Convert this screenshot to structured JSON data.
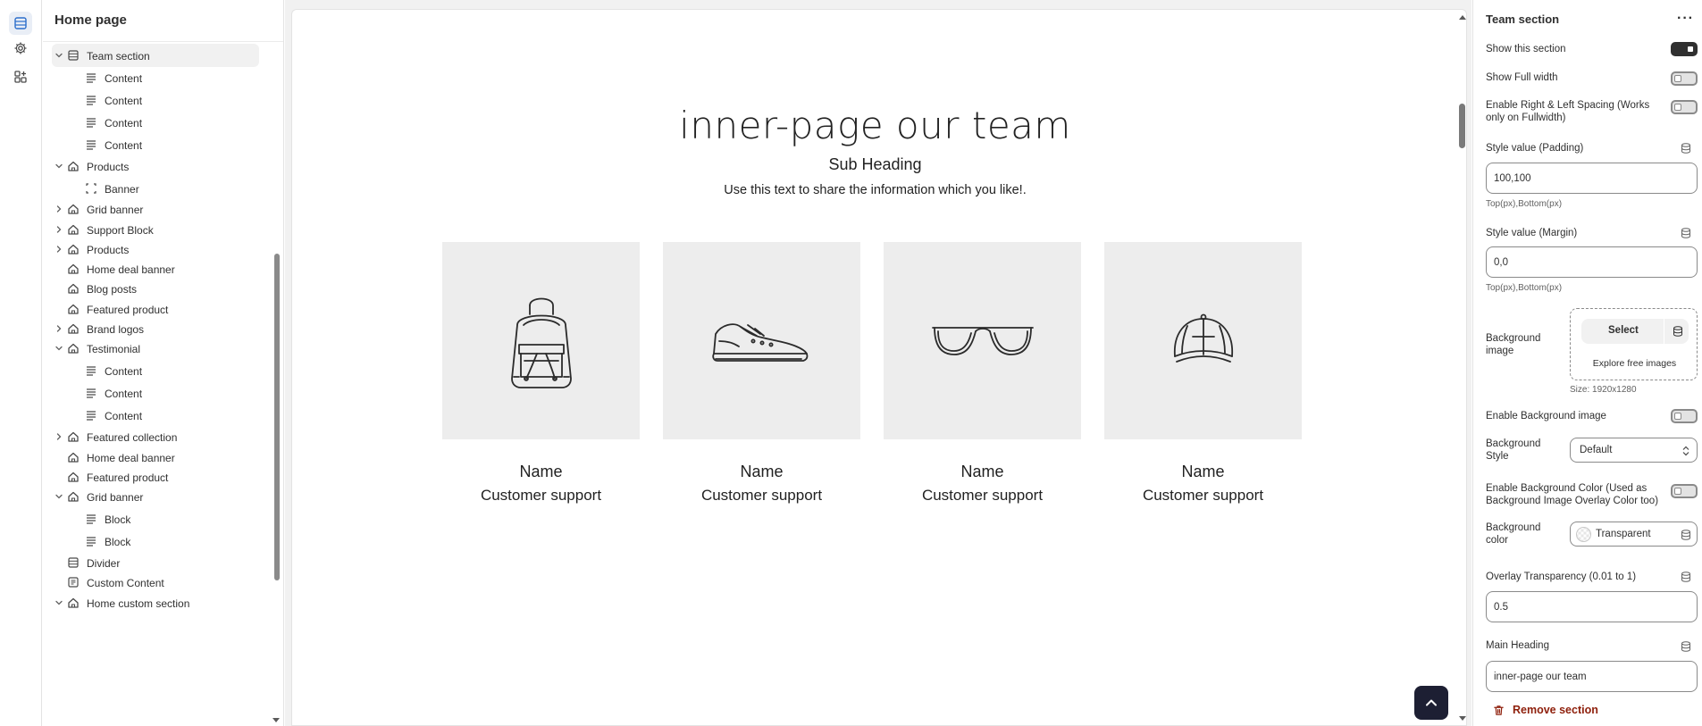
{
  "rail": {
    "items": [
      {
        "name": "sections",
        "icon": "sections-icon",
        "active": true
      },
      {
        "name": "settings",
        "icon": "gear-icon",
        "active": false
      },
      {
        "name": "apps",
        "icon": "apps-icon",
        "active": false
      }
    ]
  },
  "sidebar": {
    "title": "Home page",
    "items": [
      {
        "label": "Team section",
        "level": 0,
        "chevron": "down",
        "icon": "section-icon",
        "selected": true
      },
      {
        "label": "Content",
        "level": 1,
        "icon": "text-block-icon"
      },
      {
        "label": "Content",
        "level": 1,
        "icon": "text-block-icon"
      },
      {
        "label": "Content",
        "level": 1,
        "icon": "text-block-icon"
      },
      {
        "label": "Content",
        "level": 1,
        "icon": "text-block-icon"
      },
      {
        "label": "Products",
        "level": 0,
        "chevron": "down",
        "icon": "home-icon"
      },
      {
        "label": "Banner",
        "level": 1,
        "icon": "banner-icon"
      },
      {
        "label": "Grid banner",
        "level": 0,
        "chevron": "right",
        "icon": "home-icon"
      },
      {
        "label": "Support Block",
        "level": 0,
        "chevron": "right",
        "icon": "home-icon"
      },
      {
        "label": "Products",
        "level": 0,
        "chevron": "right",
        "icon": "home-icon"
      },
      {
        "label": "Home deal banner",
        "level": 0,
        "icon": "home-icon"
      },
      {
        "label": "Blog posts",
        "level": 0,
        "icon": "home-icon"
      },
      {
        "label": "Featured product",
        "level": 0,
        "icon": "home-icon"
      },
      {
        "label": "Brand logos",
        "level": 0,
        "chevron": "right",
        "icon": "home-icon"
      },
      {
        "label": "Testimonial",
        "level": 0,
        "chevron": "down",
        "icon": "home-icon"
      },
      {
        "label": "Content",
        "level": 1,
        "icon": "text-block-icon"
      },
      {
        "label": "Content",
        "level": 1,
        "icon": "text-block-icon"
      },
      {
        "label": "Content",
        "level": 1,
        "icon": "text-block-icon"
      },
      {
        "label": "Featured collection",
        "level": 0,
        "chevron": "right",
        "icon": "home-icon"
      },
      {
        "label": "Home deal banner",
        "level": 0,
        "icon": "home-icon"
      },
      {
        "label": "Featured product",
        "level": 0,
        "icon": "home-icon"
      },
      {
        "label": "Grid banner",
        "level": 0,
        "chevron": "down",
        "icon": "home-icon"
      },
      {
        "label": "Block",
        "level": 1,
        "icon": "text-block-icon"
      },
      {
        "label": "Block",
        "level": 1,
        "icon": "text-block-icon"
      },
      {
        "label": "Divider",
        "level": 0,
        "icon": "section-icon"
      },
      {
        "label": "Custom Content",
        "level": 0,
        "icon": "custom-content-icon"
      },
      {
        "label": "Home custom section",
        "level": 0,
        "chevron": "down",
        "icon": "home-icon"
      }
    ]
  },
  "preview": {
    "heading": "inner-page our team",
    "subheading": "Sub Heading",
    "text": "Use this text to share the information which you like!.",
    "members": [
      {
        "image": "backpack-icon",
        "name": "Name",
        "role": "Customer support"
      },
      {
        "image": "sneaker-icon",
        "name": "Name",
        "role": "Customer support"
      },
      {
        "image": "glasses-icon",
        "name": "Name",
        "role": "Customer support"
      },
      {
        "image": "cap-icon",
        "name": "Name",
        "role": "Customer support"
      }
    ]
  },
  "panel": {
    "title": "Team section",
    "more": "···",
    "show_section": {
      "label": "Show this section",
      "on": true
    },
    "show_full_width": {
      "label": "Show Full width",
      "on": false
    },
    "enable_spacing": {
      "label": "Enable Right & Left Spacing (Works only on Fullwidth)",
      "on": false
    },
    "padding": {
      "label": "Style value (Padding)",
      "value": "100,100",
      "hint": "Top(px),Bottom(px)"
    },
    "margin": {
      "label": "Style value (Margin)",
      "value": "0,0",
      "hint": "Top(px),Bottom(px)"
    },
    "bg_image": {
      "label": "Background image",
      "select": "Select",
      "explore": "Explore free images",
      "size": "Size: 1920x1280"
    },
    "enable_bg_image": {
      "label": "Enable Background image",
      "on": false
    },
    "bg_style": {
      "label": "Background Style",
      "value": "Default"
    },
    "enable_bg_color": {
      "label": "Enable Background Color (Used as Background Image Overlay Color too)",
      "on": false
    },
    "bg_color": {
      "label": "Background color",
      "value": "Transparent"
    },
    "overlay": {
      "label": "Overlay Transparency (0.01 to 1)",
      "value": "0.5"
    },
    "main_heading": {
      "label": "Main Heading",
      "value": "inner-page our team"
    },
    "remove": "Remove section"
  },
  "colors": {
    "accent": "#303030",
    "danger": "#8e1f0b",
    "back_to_top": "#1d1f33",
    "card_bg": "#ededed"
  }
}
